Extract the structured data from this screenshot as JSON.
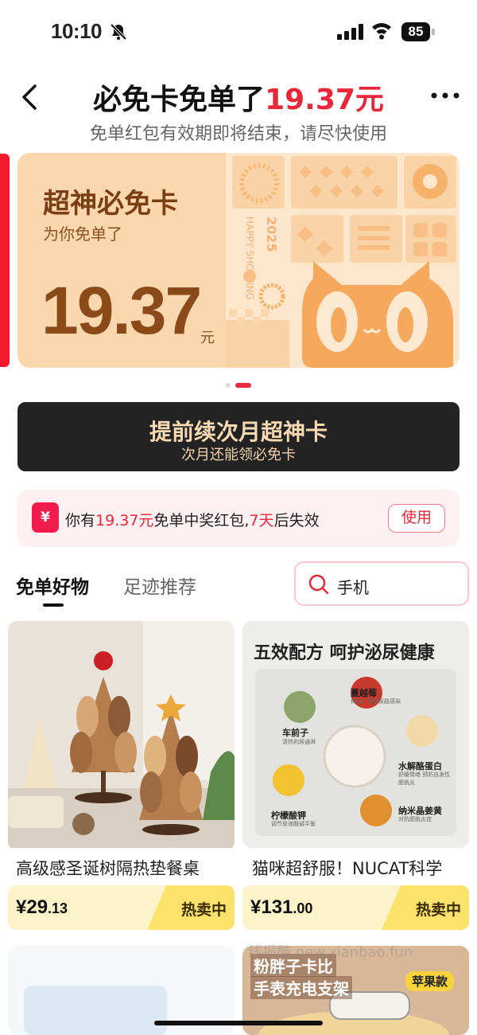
{
  "status": {
    "time": "10:10",
    "battery": "85"
  },
  "header": {
    "title_prefix": "必免卡免单了",
    "title_amount": "19.37元",
    "subtitle": "免单红包有效期即将结束，请尽快使用"
  },
  "card": {
    "title": "超神必免卡",
    "subtitle": "为你免单了",
    "amount": "19.37",
    "unit": "元",
    "deco_text_1": "HAPPY SHOPPING",
    "deco_text_2": "2025",
    "carousel_active_index": 1,
    "carousel_count": 2
  },
  "renew": {
    "label": "提前续次月超神卡",
    "sublabel": "次月还能领必免卡"
  },
  "notice": {
    "icon": "¥",
    "text_a": "你有",
    "amount": "19.37元",
    "text_b": "免单中奖红包,",
    "days": "7天",
    "text_c": "后失效",
    "button": "使用"
  },
  "tabs": [
    {
      "label": "免单好物",
      "active": true
    },
    {
      "label": "足迹推荐",
      "active": false
    }
  ],
  "search": {
    "value": "手机"
  },
  "products": [
    {
      "name": "高级感圣诞树隔热垫餐桌",
      "price_int": "¥29",
      "price_dec": ".13",
      "tag": "热卖中"
    },
    {
      "name": "猫咪超舒服！NUCAT科学",
      "price_int": "¥131",
      "price_dec": ".00",
      "tag": "热卖中",
      "img_title": "五效配方 呵护泌尿健康",
      "ingredients": [
        {
          "name": "蔓越莓",
          "desc": "抑菌，降低尿路感染"
        },
        {
          "name": "车前子",
          "desc": "清热利尿通淋"
        },
        {
          "name": "水解酪蛋白",
          "desc": "舒缓情绪 预防自发性膀胱炎"
        },
        {
          "name": "柠檬酸钾",
          "desc": "调节尿液酸碱平衡"
        },
        {
          "name": "纳米晶姜黄",
          "desc": "对抗膀胱炎症"
        }
      ]
    }
  ],
  "bottom_products": [
    {
      "title_1": "粉胖子卡比",
      "title_2": "手表充电支架",
      "tag": "苹果款"
    }
  ],
  "watermark": "线报酷 new.xianbao.fun",
  "colors": {
    "accent": "#e8283a",
    "card_bg": "#fde3c4",
    "renew_bg": "#232323",
    "hot_tag": "#fbe26a"
  }
}
